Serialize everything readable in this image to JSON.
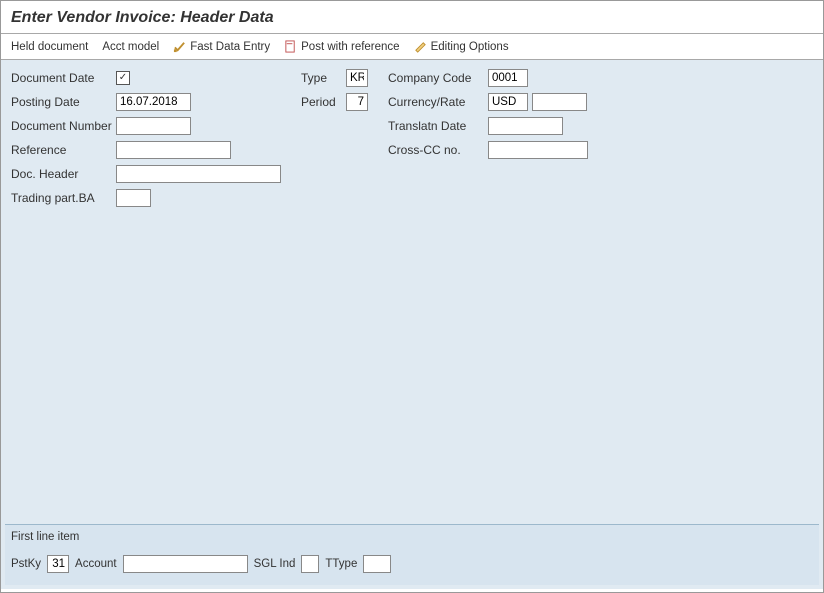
{
  "title": "Enter Vendor Invoice: Header Data",
  "toolbar": {
    "held": "Held document",
    "acct_model": "Acct model",
    "fast_entry": "Fast Data Entry",
    "post_ref": "Post with reference",
    "editing": "Editing Options"
  },
  "fields": {
    "document_date": {
      "label": "Document Date",
      "value": "",
      "checked": true
    },
    "posting_date": {
      "label": "Posting Date",
      "value": "16.07.2018"
    },
    "document_number": {
      "label": "Document Number",
      "value": ""
    },
    "reference": {
      "label": "Reference",
      "value": ""
    },
    "doc_header": {
      "label": "Doc. Header",
      "value": ""
    },
    "trading_part_ba": {
      "label": "Trading part.BA",
      "value": ""
    },
    "type": {
      "label": "Type",
      "value": "KR"
    },
    "period": {
      "label": "Period",
      "value": "7"
    },
    "company_code": {
      "label": "Company Code",
      "value": "0001"
    },
    "currency": {
      "label": "Currency/Rate",
      "value": "USD",
      "rate": ""
    },
    "translatn_date": {
      "label": "Translatn Date",
      "value": ""
    },
    "cross_cc": {
      "label": "Cross-CC no.",
      "value": ""
    }
  },
  "line_item": {
    "title": "First line item",
    "pstky": {
      "label": "PstKy",
      "value": "31"
    },
    "account": {
      "label": "Account",
      "value": ""
    },
    "sgl": {
      "label": "SGL Ind",
      "value": ""
    },
    "ttype": {
      "label": "TType",
      "value": ""
    }
  }
}
